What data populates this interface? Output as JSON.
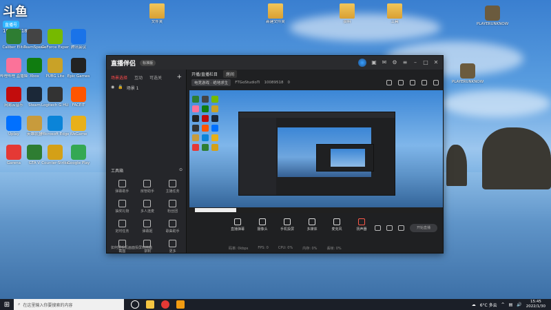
{
  "overlay": {
    "logo": "斗鱼",
    "tag": "直播号",
    "room": "10089518"
  },
  "desktop_left": [
    {
      "label": "Caliber Elite",
      "color": "#2e7d32"
    },
    {
      "label": "TeamSpeak",
      "color": "#444"
    },
    {
      "label": "GeForce Experience",
      "color": "#76b900"
    },
    {
      "label": "腾讯会议",
      "color": "#1a73e8"
    },
    {
      "label": "哔哩哔哩 直播姬",
      "color": "#fb7299"
    },
    {
      "label": "Xbox",
      "color": "#107c10"
    },
    {
      "label": "PUBG Lite",
      "color": "#c9a227"
    },
    {
      "label": "Epic Games",
      "color": "#222"
    },
    {
      "label": "网易云音乐",
      "color": "#c20c0c"
    },
    {
      "label": "Steam",
      "color": "#1b2838"
    },
    {
      "label": "Logitech G HUB",
      "color": "#333"
    },
    {
      "label": "FACEIT",
      "color": "#ff5500"
    },
    {
      "label": "Uplay",
      "color": "#0070ff"
    },
    {
      "label": "英雄联盟",
      "color": "#c89b3c"
    },
    {
      "label": "Microsoft Edge",
      "color": "#0b84d8"
    },
    {
      "label": "WeGame",
      "color": "#e8b01a"
    },
    {
      "label": "Garena",
      "color": "#e53935"
    },
    {
      "label": "GTA V",
      "color": "#2e7d32"
    },
    {
      "label": "Counter-Strike",
      "color": "#d4a017"
    },
    {
      "label": "Google Play",
      "color": "#34a853"
    }
  ],
  "desktop_top": [
    {
      "label": "文件夹"
    },
    {
      "label": "新建文件夹"
    },
    {
      "label": "资料"
    },
    {
      "label": "工具"
    }
  ],
  "desktop_right": [
    {
      "label": "PLAYERUNKNOWN'S BATTLEGROUNDS"
    },
    {
      "label": "PLAYERUNKNOWN'S BATTLEGROUNDS"
    }
  ],
  "app": {
    "title": "直播伴侣",
    "version": "标准版",
    "left_tabs": [
      "场景选择",
      "互动",
      "可选关"
    ],
    "scene": "场景 1",
    "tools_label": "工具箱",
    "tools": [
      "弹幕助手",
      "房管助手",
      "主播任务",
      "抽奖礼物",
      "多人连麦",
      "粉丝团",
      "定时任务",
      "弹幕姬",
      "歌曲助手",
      "截图",
      "录制",
      "更多"
    ],
    "left_footer": "如何把手机画面投屏到电脑",
    "main_tabs": [
      "开播/直播栏目",
      "房间"
    ],
    "info": [
      "电竞游戏 · 绝地求生",
      "FTGoStudioTi",
      "10089518",
      "0"
    ],
    "controls": [
      "直播弹幕",
      "摄像头",
      "手机投屏",
      "多媒体",
      "麦克风",
      "扬声器"
    ],
    "start_label": "开始直播",
    "status": [
      "码率: 0kbps",
      "FPS: 0",
      "CPU: 0%",
      "内存: 0%",
      "丢帧: 0%"
    ]
  },
  "taskbar": {
    "search_placeholder": "在这里输入你要搜索的内容",
    "weather": "6°C 多云",
    "time": "15:45",
    "date": "2022/1/30"
  }
}
